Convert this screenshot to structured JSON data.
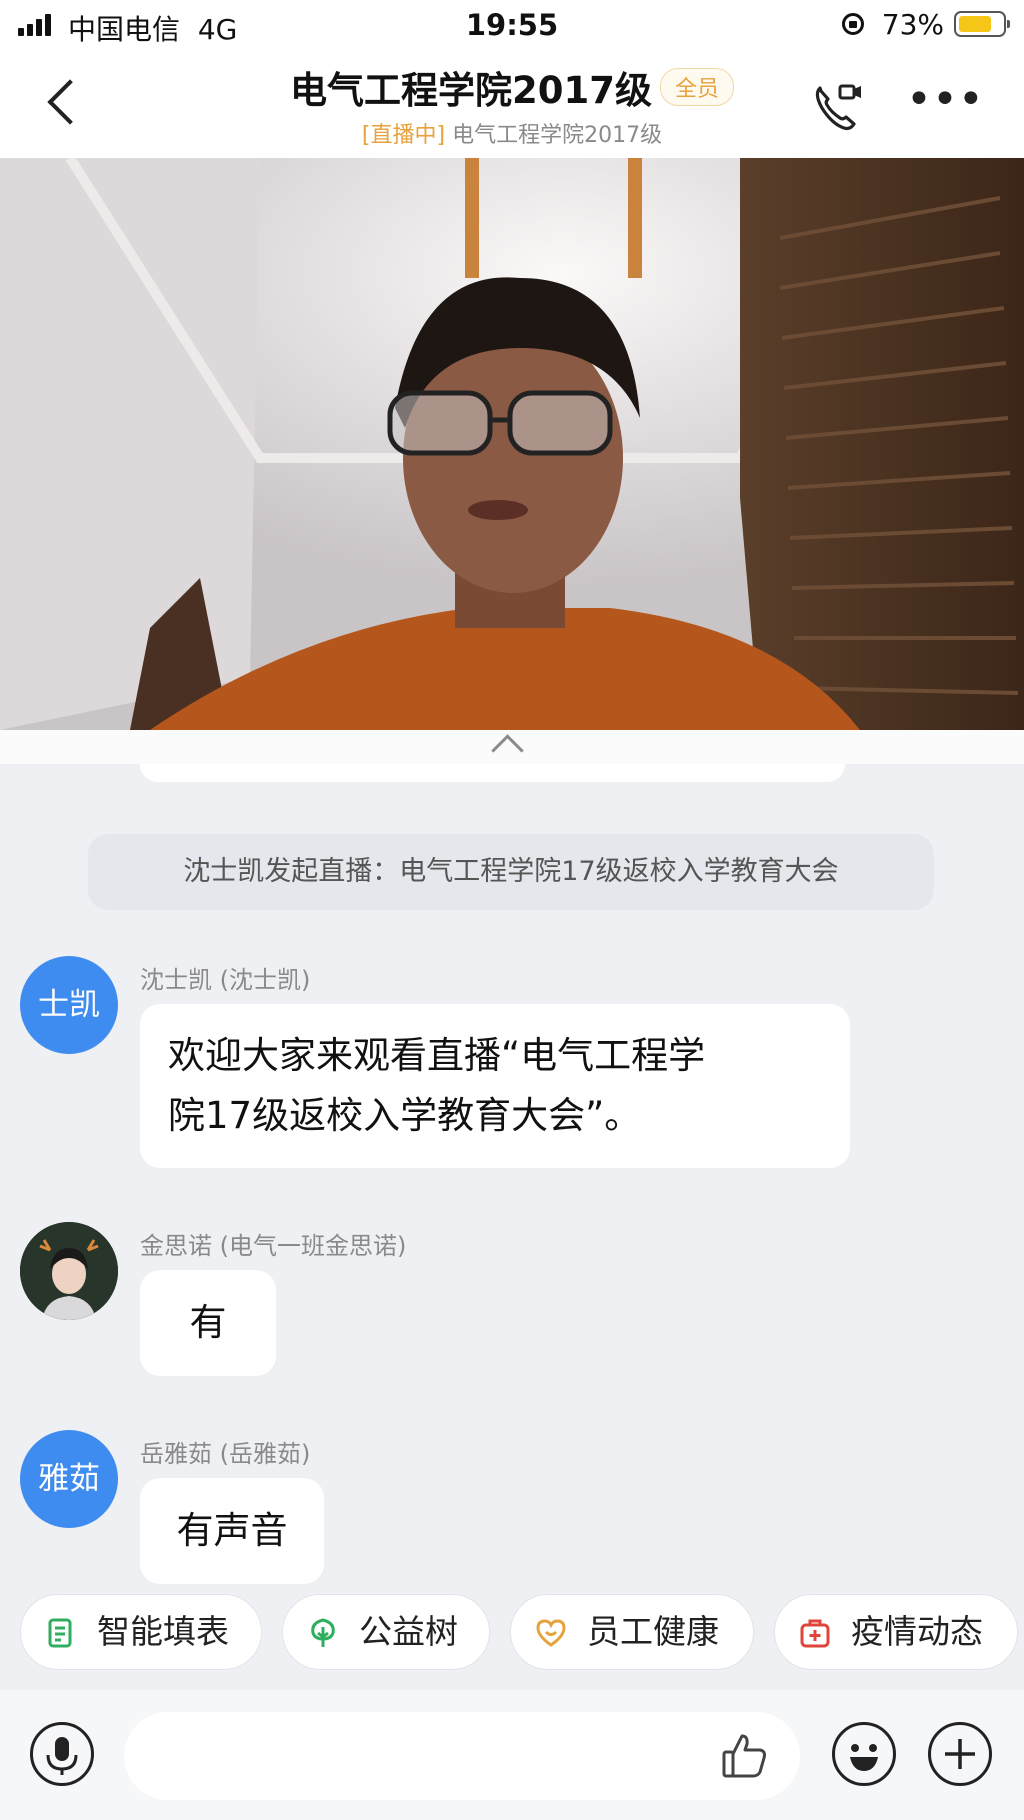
{
  "status_bar": {
    "carrier": "中国电信",
    "network": "4G",
    "time": "19:55",
    "battery": "73%"
  },
  "header": {
    "title": "电气工程学院2017级",
    "badge": "全员",
    "subtitle_live": "[直播中]",
    "subtitle_text": " 电气工程学院2017级",
    "icons": [
      "back-icon",
      "video-call-icon",
      "more-icon"
    ]
  },
  "chat": {
    "system_message": "沈士凯发起直播：电气工程学院17级返校入学教育大会",
    "messages": [
      {
        "avatar_text": "士凯",
        "sender": "沈士凯 (沈士凯)",
        "lines": [
          "欢迎大家来观看直播“电气工程学",
          "院17级返校入学教育大会”。"
        ]
      },
      {
        "avatar_text": "",
        "sender": "金思诺 (电气一班金思诺)",
        "lines": [
          "有"
        ]
      },
      {
        "avatar_text": "雅茹",
        "sender": "岳雅茹 (岳雅茹)",
        "lines": [
          "有声音"
        ]
      }
    ]
  },
  "quick_actions": [
    {
      "label": "智能填表",
      "icon": "form-icon",
      "color": "#2fae5f"
    },
    {
      "label": "公益树",
      "icon": "tree-icon",
      "color": "#2fae5f"
    },
    {
      "label": "员工健康",
      "icon": "heart-icon",
      "color": "#e6a23c"
    },
    {
      "label": "疫情动态",
      "icon": "medkit-icon",
      "color": "#e0443a"
    }
  ],
  "input_bar": {
    "icons": [
      "microphone-icon",
      "thumbs-up-icon",
      "emoji-icon",
      "plus-icon"
    ]
  }
}
